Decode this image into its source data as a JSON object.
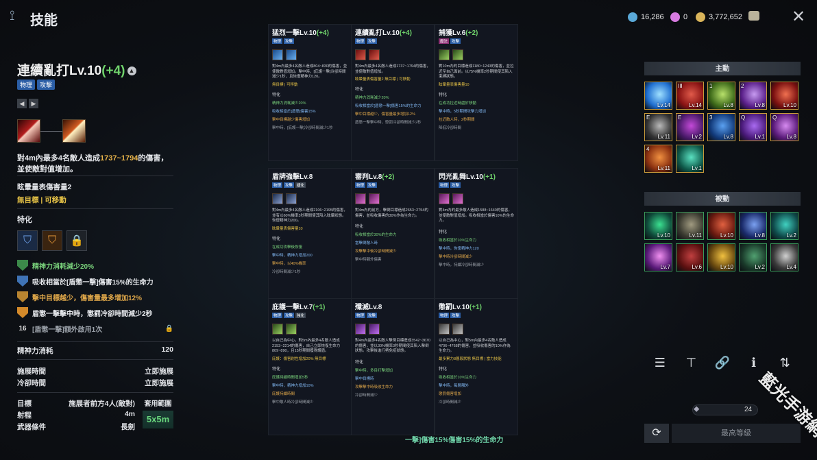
{
  "header": {
    "title": "技能",
    "currencies": [
      {
        "icon": "crystal-icon",
        "value": "16,286",
        "color": "#5aa9d8"
      },
      {
        "icon": "gem-icon",
        "value": "0",
        "color": "#d77be0"
      },
      {
        "icon": "gold-coin-icon",
        "value": "3,772,652",
        "color": "#d9b45a"
      }
    ]
  },
  "skill": {
    "name": "連續亂打Lv.10",
    "plus": "(+4)",
    "tags": [
      "物理",
      "攻擊"
    ],
    "desc_pre": "對4m內最多4名敵人造成",
    "desc_hl": "1737~1794",
    "desc_post": "的傷害，並使敵對值增加。",
    "line1": "眩暈量表傷害量2",
    "line2": "無目標 | 可移動",
    "spec_label": "特化",
    "effects": [
      {
        "text": "精神力消耗減少20%",
        "color": "#7ad37c",
        "icon_color": "#3c8a4a"
      },
      {
        "text": "吸收相當於[盾懲一擊]傷害15%的生命力",
        "color": "#e6e8ec",
        "icon_color": "#3f73b5"
      },
      {
        "text": "擊中目標越少，傷害量最多增加12%",
        "color": "#e0a84a",
        "icon_color": "#b88430"
      },
      {
        "text": "盾懲一擊擊中時，懲罰冷卻時間減少2秒",
        "color": "#e6e8ec",
        "icon_color": "#d48a2a"
      }
    ],
    "lvl16": {
      "level": "16",
      "text": "[盾懲一擊]額外啟用1次"
    },
    "mp_label": "精神力消耗",
    "mp_value": "120",
    "cast_label": "施展時間",
    "cast_value": "立即施展",
    "cd_label": "冷卻時間",
    "cd_value": "立即施展",
    "target_label": "目標",
    "target_value": "施展者前方4人(敵對)",
    "range_label": "射程",
    "range_value": "4m",
    "weapon_label": "武器條件",
    "weapon_value": "長劍",
    "area_label": "套用範圍",
    "area_value": "5x5m"
  },
  "collage": {
    "cards": [
      {
        "title": "猛烈一擊Lv.10",
        "plus": "(+4)",
        "tags": [
          "物理",
          "攻擊"
        ],
        "desc": "對4m內最多4名敵人造成804~830的傷害，並使敵對值增加。擊中時，[庇護一擊]冷卻時間減少1秒，且恢復精神力120。",
        "sub": "無目標 | 可移動",
        "lines": [
          "精神力消耗減少20%",
          "吸收相當於[盾懲]傷害15%",
          "擊中目標越少傷害增加",
          "擊中時，[庇護一擊]冷卻時間減少1秒"
        ]
      },
      {
        "title": "連續亂打Lv.10",
        "plus": "(+4)",
        "tags": [
          "物理",
          "攻擊"
        ],
        "desc": "對4m內最多4名敵人造成1737~1794的傷害，並使敵對值增加。",
        "sub": "眩暈量表傷害量2 無目標 | 可移動",
        "lines": [
          "精神力消耗減少20%",
          "吸收相當於[盾懲一擊]傷害15%的生命力",
          "擊中目標越少，傷害量最多增加12%",
          "盾懲一擊擊中時，懲罰冷卻時間減少2秒"
        ]
      },
      {
        "title": "捕獲Lv.6",
        "plus": "(+2)",
        "tags": [
          "魔法",
          "攻擊"
        ],
        "desc": "對10m內的目標造成1180~1243的傷害，並拉近至自己面前。以75%機率2秒期間使其陷入束縛狀態。",
        "sub": "眩暈量表傷害量10",
        "lines": [
          "在成功拉近時處於移動",
          "擊中時，5秒期間攻擊力增加",
          "拉近敵人時，2秒期間",
          "降低冷卻時間"
        ]
      },
      {
        "title": "盾牌強擊Lv.8",
        "plus": "",
        "tags": [
          "物理",
          "攻擊",
          "緩化"
        ],
        "desc": "對4m內最多4名敵人造成2106~2195的傷害，並有以60%機率3秒期間使其陷入眩暈狀態。恢復精神力200。",
        "sub": "眩暈量表傷害量10",
        "lines": [
          "在成功攻擊後恢復",
          "擊中時，精神力增加200",
          "擊中時，以40%機率",
          "冷卻時間減少1秒"
        ]
      },
      {
        "title": "審判Lv.8",
        "plus": "(+2)",
        "tags": [
          "物理",
          "攻擊"
        ],
        "desc": "對4m內的前方，擊倒目標造成2653~2754的傷害，並吸收傷害的30%作為生命力。",
        "sub": "",
        "lines": [
          "吸收相當於30%的生命力",
          "當擊倒敵人時",
          "攻擊擊中後冷卻時間減少",
          "擊中時額外傷害"
        ]
      },
      {
        "title": "閃光亂舞Lv.10",
        "plus": "(+1)",
        "tags": [
          "物理",
          "攻擊"
        ],
        "desc": "對4m內的最多敵人造成1588~1640的傷害，並使敵對值增加。吸收相當於傷害10%的生命力。",
        "sub": "",
        "lines": [
          "吸收相當於10%生命力",
          "擊中時，恢復精神力120",
          "擊中時冷卻時間減少",
          "擊中時，持續冷卻時間減少"
        ]
      },
      {
        "title": "庇護一擊Lv.7",
        "plus": "(+1)",
        "tags": [
          "物理",
          "攻擊",
          "強化"
        ],
        "desc": "以自己為中心，對5m內最多4名敵人造成2153~2214的傷害，自己立即恢復生命力809~890，且15秒期間獲得護盾。",
        "sub": "庇護：傷害耐性增加20% 無目標",
        "lines": [
          "庇護持續時間增加5秒",
          "擊中時，精神力增加10%",
          "庇護持續時間",
          "擊中敵人時冷卻時間減少"
        ]
      },
      {
        "title": "殲滅Lv.8",
        "plus": "",
        "tags": [
          "物理",
          "攻擊"
        ],
        "desc": "對4m內最多4名敵人擊倒目標造成3542~3670的傷害，並以30%機率3秒期間使其陷入擊倒狀態。攻擊後進行勢免疫狀態。",
        "sub": "",
        "lines": [
          "擊中時，多目打擊增加",
          "擊中目標時",
          "攻擊擊中時吸收生命力",
          "冷卻時間減少"
        ]
      },
      {
        "title": "懲罰Lv.10",
        "plus": "(+1)",
        "tags": [
          "物理",
          "攻擊"
        ],
        "desc": "以自己為中心，對5m內最多4名敵人造成4706~4768的傷害，並吸收傷害的10%作為生命力。",
        "sub": "最多累力8層段狀態 無目標 | 當力技能",
        "lines": [
          "吸收相當於10%生命力",
          "擊中時，每層額外",
          "懲罰傷害增加",
          "冷卻時間減少"
        ]
      }
    ],
    "caption": "一擊]傷害15%傷害15%的生命力"
  },
  "right": {
    "active_label": "主動",
    "passive_label": "被動",
    "active_slots": [
      {
        "lv": "Lv.14",
        "key": "",
        "c1": "#1f6fd1",
        "c2": "#9fe0ff"
      },
      {
        "lv": "Lv.14",
        "key": "III",
        "c1": "#8a1414",
        "c2": "#e05a4a"
      },
      {
        "lv": "Lv.8",
        "key": "1",
        "c1": "#3e6a1a",
        "c2": "#b7e06a"
      },
      {
        "lv": "Lv.8",
        "key": "2",
        "c1": "#5a1f8a",
        "c2": "#c69af0"
      },
      {
        "lv": "Lv.10",
        "key": "",
        "c1": "#7a1010",
        "c2": "#f07050"
      },
      {
        "lv": "Lv.11",
        "key": "E",
        "c1": "#333",
        "c2": "#b9b9b9"
      },
      {
        "lv": "Lv.2",
        "key": "E",
        "c1": "#4a1a6a",
        "c2": "#c34ad8"
      },
      {
        "lv": "Lv.8",
        "key": "3",
        "c1": "#123a7a",
        "c2": "#5aa0f0"
      },
      {
        "lv": "Lv.1",
        "key": "Q",
        "c1": "#4a1a7a",
        "c2": "#a86af0"
      },
      {
        "lv": "Lv.8",
        "key": "Q",
        "c1": "#5a1a7a",
        "c2": "#d68af0"
      },
      {
        "lv": "Lv.11",
        "key": "4",
        "c1": "#8a3010",
        "c2": "#f09040"
      },
      {
        "lv": "Lv.1",
        "key": "",
        "c1": "#0f5a4a",
        "c2": "#5ae0c0"
      }
    ],
    "passive_slots": [
      {
        "lv": "Lv.10",
        "c1": "#0f4a3a",
        "c2": "#3ae090"
      },
      {
        "lv": "Lv.11",
        "c1": "#3a3a30",
        "c2": "#a09a80"
      },
      {
        "lv": "Lv.10",
        "c1": "#6a1a10",
        "c2": "#e06040"
      },
      {
        "lv": "Lv.8",
        "c1": "#1a2a6a",
        "c2": "#7aa0f0"
      },
      {
        "lv": "Lv.2",
        "c1": "#0f4a4a",
        "c2": "#40d0c0"
      },
      {
        "lv": "Lv.7",
        "c1": "#5a1a7a",
        "c2": "#f090f0"
      },
      {
        "lv": "Lv.6",
        "c1": "#5a1010",
        "c2": "#c04040"
      },
      {
        "lv": "Lv.10",
        "c1": "#6a4a10",
        "c2": "#f0c040"
      },
      {
        "lv": "Lv.2",
        "c1": "#1a3a2a",
        "c2": "#50a070"
      },
      {
        "lv": "Lv.4",
        "c1": "#3a3a3a",
        "c2": "#d0d0d0"
      }
    ],
    "slider_value": "24",
    "max_level_label": "最高等級"
  },
  "watermark": "藍光手游網"
}
